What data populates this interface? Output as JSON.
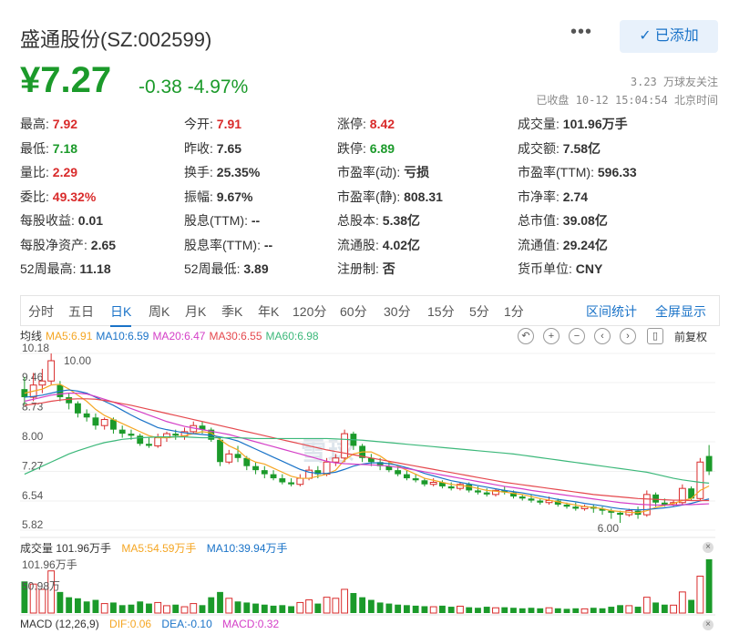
{
  "header": {
    "stock_name": "盛通股份(SZ:002599)",
    "more_label": "•••",
    "follow_label": "已添加"
  },
  "quote": {
    "price": "¥7.27",
    "change": "-0.38 -4.97%",
    "followers": "3.23 万球友关注",
    "status": "已收盘 10-12 15:04:54 北京时间"
  },
  "stats": [
    {
      "label": "最高:",
      "value": "7.92",
      "tone": "up"
    },
    {
      "label": "今开:",
      "value": "7.91",
      "tone": "up"
    },
    {
      "label": "涨停:",
      "value": "8.42",
      "tone": "up"
    },
    {
      "label": "成交量:",
      "value": "101.96万手",
      "tone": ""
    },
    {
      "label": "最低:",
      "value": "7.18",
      "tone": "down"
    },
    {
      "label": "昨收:",
      "value": "7.65",
      "tone": ""
    },
    {
      "label": "跌停:",
      "value": "6.89",
      "tone": "down"
    },
    {
      "label": "成交额:",
      "value": "7.58亿",
      "tone": ""
    },
    {
      "label": "量比:",
      "value": "2.29",
      "tone": "up"
    },
    {
      "label": "换手:",
      "value": "25.35%",
      "tone": ""
    },
    {
      "label": "市盈率(动):",
      "value": "亏损",
      "tone": ""
    },
    {
      "label": "市盈率(TTM):",
      "value": "596.33",
      "tone": ""
    },
    {
      "label": "委比:",
      "value": "49.32%",
      "tone": "up"
    },
    {
      "label": "振幅:",
      "value": "9.67%",
      "tone": ""
    },
    {
      "label": "市盈率(静):",
      "value": "808.31",
      "tone": ""
    },
    {
      "label": "市净率:",
      "value": "2.74",
      "tone": ""
    },
    {
      "label": "每股收益:",
      "value": "0.01",
      "tone": ""
    },
    {
      "label": "股息(TTM):",
      "value": "--",
      "tone": ""
    },
    {
      "label": "总股本:",
      "value": "5.38亿",
      "tone": ""
    },
    {
      "label": "总市值:",
      "value": "39.08亿",
      "tone": ""
    },
    {
      "label": "每股净资产:",
      "value": "2.65",
      "tone": ""
    },
    {
      "label": "股息率(TTM):",
      "value": "--",
      "tone": ""
    },
    {
      "label": "流通股:",
      "value": "4.02亿",
      "tone": ""
    },
    {
      "label": "流通值:",
      "value": "29.24亿",
      "tone": ""
    },
    {
      "label": "52周最高:",
      "value": "11.18",
      "tone": ""
    },
    {
      "label": "52周最低:",
      "value": "3.89",
      "tone": ""
    },
    {
      "label": "注册制:",
      "value": "否",
      "tone": ""
    },
    {
      "label": "货币单位:",
      "value": "CNY",
      "tone": ""
    }
  ],
  "tabs": [
    "分时",
    "五日",
    "日K",
    "周K",
    "月K",
    "季K",
    "年K",
    "120分",
    "60分",
    "30分",
    "15分",
    "5分",
    "1分"
  ],
  "active_tab": "日K",
  "tab_actions": [
    "区间统计",
    "全屏显示"
  ],
  "ma": {
    "title": "均线",
    "items": [
      {
        "text": "MA5:6.91",
        "color": "#f5a623"
      },
      {
        "text": "MA10:6.59",
        "color": "#1a73c8"
      },
      {
        "text": "MA20:6.47",
        "color": "#d43fc7"
      },
      {
        "text": "MA30:6.55",
        "color": "#e5484d"
      },
      {
        "text": "MA60:6.98",
        "color": "#3cb87a"
      }
    ],
    "adjust": "前复权"
  },
  "chart_labels": {
    "y_ticks": [
      "10.18",
      "9.46",
      "8.73",
      "8.00",
      "7.27",
      "6.54",
      "5.82"
    ],
    "high_mark": "10.00",
    "low_mark": "6.00",
    "watermark": "雪球"
  },
  "volume": {
    "title": "成交量 101.96万手",
    "ma5": "MA5:54.59万手",
    "ma10": "MA10:39.94万手",
    "max_label": "101.96万手",
    "mid_label": "50.98万"
  },
  "macd": {
    "title": "MACD (12,26,9)",
    "dif": "DIF:0.06",
    "dea": "DEA:-0.10",
    "macd": "MACD:0.32"
  },
  "colors": {
    "up": "#d92b2b",
    "down": "#1b9a2a",
    "accent": "#1a73c8"
  },
  "chart_data": {
    "type": "candlestick",
    "y_range": [
      5.82,
      10.18
    ],
    "candles": [
      [
        9.3,
        9.1,
        9.6,
        8.9
      ],
      [
        9.1,
        9.4,
        9.7,
        9.0
      ],
      [
        9.4,
        9.5,
        9.8,
        9.2
      ],
      [
        9.5,
        10.0,
        10.18,
        9.4
      ],
      [
        9.4,
        9.1,
        9.5,
        9.0
      ],
      [
        9.1,
        8.95,
        9.2,
        8.8
      ],
      [
        8.95,
        8.7,
        9.0,
        8.6
      ],
      [
        8.7,
        8.6,
        8.8,
        8.5
      ],
      [
        8.6,
        8.4,
        8.7,
        8.3
      ],
      [
        8.4,
        8.55,
        8.6,
        8.3
      ],
      [
        8.55,
        8.3,
        8.6,
        8.2
      ],
      [
        8.3,
        8.2,
        8.4,
        8.1
      ],
      [
        8.2,
        8.15,
        8.3,
        8.05
      ],
      [
        8.15,
        7.95,
        8.2,
        7.9
      ],
      [
        7.95,
        7.9,
        8.1,
        7.85
      ],
      [
        7.9,
        8.1,
        8.2,
        7.85
      ],
      [
        8.1,
        8.2,
        8.25,
        8.0
      ],
      [
        8.2,
        8.15,
        8.3,
        8.05
      ],
      [
        8.15,
        8.25,
        8.35,
        8.05
      ],
      [
        8.25,
        8.4,
        8.5,
        8.2
      ],
      [
        8.4,
        8.3,
        8.5,
        8.2
      ],
      [
        8.3,
        8.05,
        8.35,
        8.0
      ],
      [
        8.05,
        7.5,
        8.1,
        7.4
      ],
      [
        7.5,
        7.7,
        7.8,
        7.45
      ],
      [
        7.7,
        7.6,
        7.9,
        7.5
      ],
      [
        7.6,
        7.4,
        7.65,
        7.3
      ],
      [
        7.4,
        7.3,
        7.5,
        7.2
      ],
      [
        7.3,
        7.2,
        7.4,
        7.1
      ],
      [
        7.2,
        7.1,
        7.3,
        7.05
      ],
      [
        7.1,
        7.0,
        7.2,
        6.95
      ],
      [
        7.0,
        6.95,
        7.1,
        6.9
      ],
      [
        6.95,
        7.1,
        7.2,
        6.9
      ],
      [
        7.1,
        7.3,
        7.4,
        7.05
      ],
      [
        7.3,
        7.2,
        7.4,
        7.1
      ],
      [
        7.2,
        7.5,
        7.6,
        7.15
      ],
      [
        7.5,
        7.6,
        7.7,
        7.4
      ],
      [
        7.6,
        8.2,
        8.3,
        7.5
      ],
      [
        8.2,
        7.9,
        8.25,
        7.8
      ],
      [
        7.9,
        7.6,
        7.95,
        7.5
      ],
      [
        7.6,
        7.5,
        7.7,
        7.4
      ],
      [
        7.5,
        7.4,
        7.6,
        7.3
      ],
      [
        7.4,
        7.3,
        7.5,
        7.25
      ],
      [
        7.3,
        7.2,
        7.4,
        7.15
      ],
      [
        7.2,
        7.1,
        7.3,
        7.05
      ],
      [
        7.1,
        7.05,
        7.2,
        7.0
      ],
      [
        7.05,
        6.95,
        7.1,
        6.9
      ],
      [
        6.95,
        7.0,
        7.1,
        6.9
      ],
      [
        7.0,
        6.9,
        7.05,
        6.85
      ],
      [
        6.9,
        6.85,
        7.0,
        6.8
      ],
      [
        6.85,
        6.95,
        7.0,
        6.8
      ],
      [
        6.95,
        6.8,
        7.0,
        6.75
      ],
      [
        6.8,
        6.75,
        6.9,
        6.7
      ],
      [
        6.75,
        6.7,
        6.85,
        6.65
      ],
      [
        6.7,
        6.8,
        6.85,
        6.65
      ],
      [
        6.8,
        6.75,
        6.9,
        6.7
      ],
      [
        6.75,
        6.65,
        6.8,
        6.6
      ],
      [
        6.65,
        6.6,
        6.7,
        6.55
      ],
      [
        6.6,
        6.55,
        6.7,
        6.5
      ],
      [
        6.55,
        6.5,
        6.6,
        6.45
      ],
      [
        6.5,
        6.55,
        6.65,
        6.45
      ],
      [
        6.55,
        6.45,
        6.6,
        6.4
      ],
      [
        6.45,
        6.4,
        6.5,
        6.35
      ],
      [
        6.4,
        6.35,
        6.5,
        6.3
      ],
      [
        6.35,
        6.4,
        6.45,
        6.3
      ],
      [
        6.4,
        6.35,
        6.45,
        6.25
      ],
      [
        6.35,
        6.3,
        6.4,
        6.2
      ],
      [
        6.3,
        6.25,
        6.35,
        6.1
      ],
      [
        6.25,
        6.2,
        6.3,
        6.0
      ],
      [
        6.2,
        6.3,
        6.35,
        6.15
      ],
      [
        6.3,
        6.2,
        6.4,
        6.1
      ],
      [
        6.2,
        6.7,
        6.8,
        6.15
      ],
      [
        6.7,
        6.5,
        6.75,
        6.4
      ],
      [
        6.5,
        6.45,
        6.6,
        6.4
      ],
      [
        6.45,
        6.5,
        6.55,
        6.4
      ],
      [
        6.5,
        6.85,
        6.95,
        6.45
      ],
      [
        6.85,
        6.6,
        6.9,
        6.55
      ],
      [
        6.6,
        7.5,
        7.6,
        6.55
      ],
      [
        7.65,
        7.27,
        7.92,
        7.18
      ]
    ],
    "volumes": [
      60,
      55,
      45,
      80,
      40,
      30,
      28,
      22,
      25,
      18,
      20,
      15,
      16,
      22,
      18,
      20,
      14,
      16,
      12,
      18,
      15,
      30,
      40,
      28,
      22,
      20,
      18,
      16,
      14,
      15,
      13,
      20,
      25,
      18,
      30,
      28,
      45,
      38,
      30,
      25,
      20,
      18,
      16,
      15,
      14,
      13,
      12,
      14,
      12,
      13,
      11,
      10,
      12,
      10,
      11,
      10,
      9,
      10,
      9,
      10,
      9,
      8,
      9,
      8,
      10,
      9,
      12,
      15,
      14,
      12,
      30,
      20,
      16,
      15,
      40,
      25,
      70,
      102
    ],
    "ma5": [
      9.2,
      9.25,
      9.3,
      9.4,
      9.42,
      9.3,
      9.15,
      9.0,
      8.8,
      8.65,
      8.55,
      8.45,
      8.35,
      8.25,
      8.15,
      8.1,
      8.1,
      8.12,
      8.15,
      8.2,
      8.25,
      8.22,
      8.05,
      7.9,
      7.8,
      7.6,
      7.5,
      7.45,
      7.35,
      7.25,
      7.15,
      7.1,
      7.1,
      7.15,
      7.2,
      7.3,
      7.55,
      7.7,
      7.75,
      7.75,
      7.65,
      7.5,
      7.4,
      7.3,
      7.2,
      7.1,
      7.05,
      7.0,
      6.95,
      6.92,
      6.9,
      6.85,
      6.8,
      6.78,
      6.76,
      6.73,
      6.7,
      6.65,
      6.6,
      6.56,
      6.52,
      6.48,
      6.44,
      6.4,
      6.38,
      6.35,
      6.3,
      6.28,
      6.26,
      6.25,
      6.3,
      6.38,
      6.43,
      6.48,
      6.55,
      6.6,
      6.8,
      6.91
    ],
    "ma10": [
      9.1,
      9.12,
      9.15,
      9.2,
      9.25,
      9.28,
      9.25,
      9.2,
      9.1,
      9.0,
      8.9,
      8.78,
      8.66,
      8.55,
      8.45,
      8.35,
      8.3,
      8.26,
      8.22,
      8.2,
      8.18,
      8.16,
      8.12,
      8.08,
      8.02,
      7.92,
      7.82,
      7.72,
      7.62,
      7.52,
      7.42,
      7.32,
      7.25,
      7.22,
      7.22,
      7.25,
      7.32,
      7.4,
      7.45,
      7.48,
      7.48,
      7.46,
      7.42,
      7.36,
      7.3,
      7.22,
      7.16,
      7.1,
      7.04,
      7.0,
      6.96,
      6.92,
      6.88,
      6.84,
      6.8,
      6.77,
      6.74,
      6.7,
      6.66,
      6.62,
      6.58,
      6.55,
      6.52,
      6.48,
      6.45,
      6.42,
      6.38,
      6.35,
      6.33,
      6.32,
      6.33,
      6.35,
      6.37,
      6.4,
      6.44,
      6.48,
      6.54,
      6.59
    ],
    "ma20": [
      9.0,
      9.05,
      9.1,
      9.15,
      9.18,
      9.2,
      9.2,
      9.18,
      9.12,
      9.05,
      8.98,
      8.9,
      8.82,
      8.74,
      8.66,
      8.58,
      8.5,
      8.44,
      8.38,
      8.34,
      8.3,
      8.26,
      8.22,
      8.18,
      8.12,
      8.06,
      8.0,
      7.94,
      7.88,
      7.82,
      7.76,
      7.7,
      7.64,
      7.58,
      7.52,
      7.48,
      7.46,
      7.45,
      7.44,
      7.43,
      7.42,
      7.4,
      7.37,
      7.34,
      7.3,
      7.26,
      7.22,
      7.18,
      7.14,
      7.1,
      7.06,
      7.02,
      6.98,
      6.94,
      6.9,
      6.87,
      6.84,
      6.8,
      6.77,
      6.74,
      6.71,
      6.68,
      6.65,
      6.62,
      6.59,
      6.56,
      6.53,
      6.5,
      6.48,
      6.46,
      6.45,
      6.44,
      6.44,
      6.44,
      6.45,
      6.45,
      6.46,
      6.47
    ],
    "ma30": [
      8.9,
      8.93,
      8.96,
      9.0,
      9.03,
      9.05,
      9.06,
      9.06,
      9.05,
      9.02,
      8.98,
      8.94,
      8.9,
      8.85,
      8.8,
      8.75,
      8.7,
      8.65,
      8.6,
      8.55,
      8.5,
      8.45,
      8.4,
      8.35,
      8.3,
      8.25,
      8.2,
      8.15,
      8.1,
      8.05,
      8.0,
      7.95,
      7.9,
      7.85,
      7.8,
      7.76,
      7.72,
      7.68,
      7.64,
      7.6,
      7.56,
      7.52,
      7.48,
      7.44,
      7.4,
      7.36,
      7.32,
      7.28,
      7.24,
      7.2,
      7.16,
      7.12,
      7.08,
      7.04,
      7.0,
      6.97,
      6.94,
      6.91,
      6.88,
      6.85,
      6.82,
      6.79,
      6.76,
      6.73,
      6.7,
      6.68,
      6.66,
      6.64,
      6.62,
      6.6,
      6.59,
      6.58,
      6.57,
      6.56,
      6.56,
      6.55,
      6.55,
      6.55
    ],
    "ma60": [
      7.2,
      7.3,
      7.4,
      7.5,
      7.6,
      7.7,
      7.78,
      7.85,
      7.92,
      7.98,
      8.02,
      8.06,
      8.08,
      8.1,
      8.11,
      8.12,
      8.12,
      8.12,
      8.12,
      8.11,
      8.1,
      8.1,
      8.1,
      8.1,
      8.1,
      8.09,
      8.08,
      8.08,
      8.08,
      8.08,
      8.08,
      8.08,
      8.08,
      8.08,
      8.08,
      8.07,
      8.06,
      8.05,
      8.04,
      8.02,
      8.0,
      7.98,
      7.96,
      7.94,
      7.92,
      7.9,
      7.88,
      7.86,
      7.84,
      7.82,
      7.8,
      7.78,
      7.76,
      7.74,
      7.72,
      7.7,
      7.67,
      7.64,
      7.61,
      7.58,
      7.55,
      7.52,
      7.49,
      7.46,
      7.43,
      7.4,
      7.37,
      7.34,
      7.31,
      7.28,
      7.25,
      7.2,
      7.15,
      7.1,
      7.06,
      7.03,
      7.0,
      6.98
    ]
  }
}
